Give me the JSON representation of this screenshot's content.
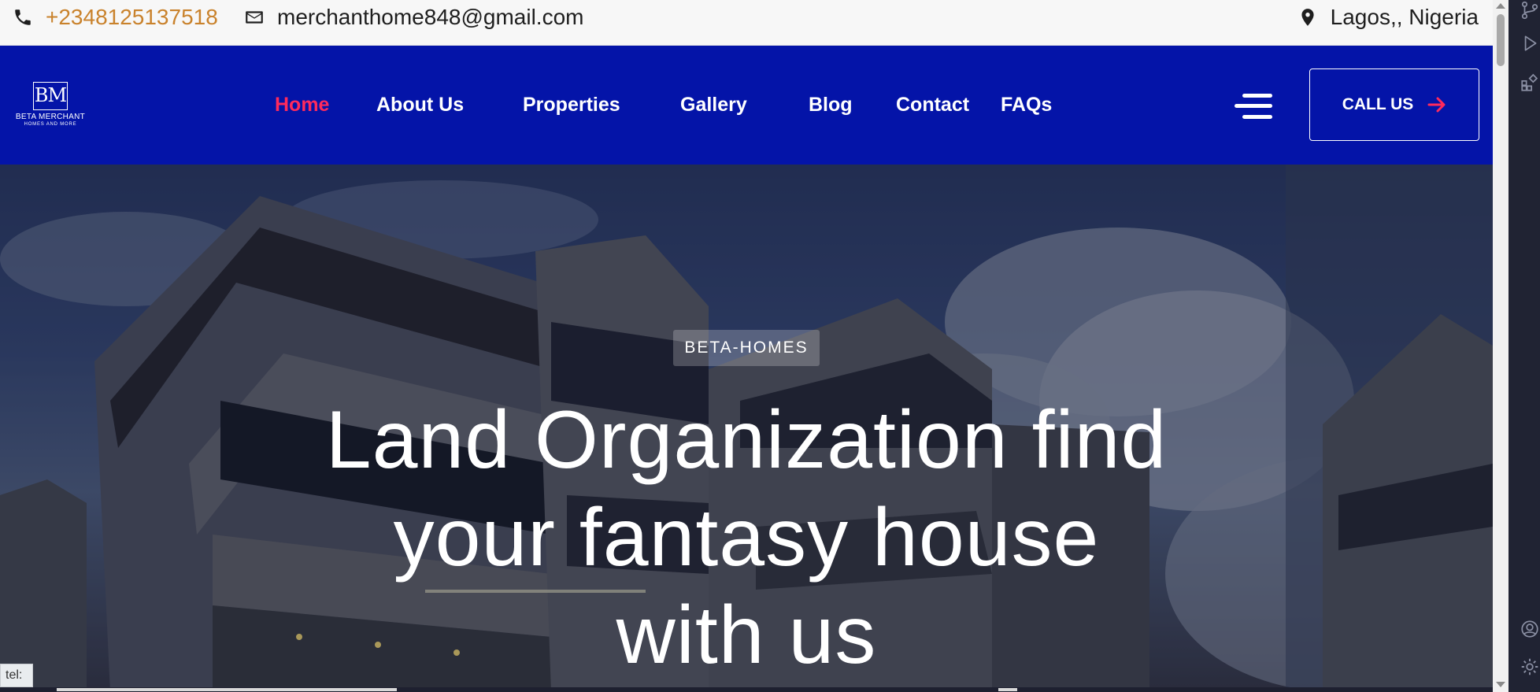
{
  "topbar": {
    "phone": "+2348125137518",
    "email": "merchanthome848@gmail.com",
    "location": "Lagos,, Nigeria"
  },
  "logo": {
    "monogram": "BM",
    "name": "BETA MERCHANT",
    "tagline": "HOMES AND MORE"
  },
  "nav": {
    "items": [
      {
        "label": "Home",
        "active": true
      },
      {
        "label": "About Us"
      },
      {
        "label": "Properties"
      },
      {
        "label": "Gallery"
      },
      {
        "label": "Blog"
      },
      {
        "label": "Contact"
      },
      {
        "label": "FAQs"
      }
    ],
    "call_label": "CALL US"
  },
  "hero": {
    "badge": "BETA-HOMES",
    "headline_lines": [
      "Land Organization find",
      "your fantasy house",
      "with us"
    ]
  },
  "status_text": "tel:",
  "colors": {
    "nav_bg": "#0414a8",
    "active": "#ff2a5c",
    "phone": "#c9822c",
    "arrow": "#ff2a5c"
  }
}
